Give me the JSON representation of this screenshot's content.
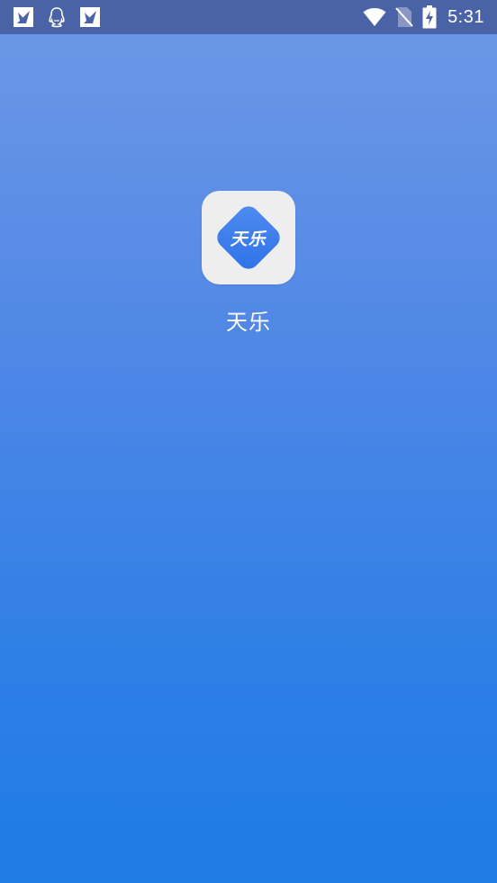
{
  "status_bar": {
    "time": "5:31",
    "left_icons": [
      "gallery-notification-icon",
      "qq-penguin-icon",
      "gallery-notification-icon"
    ],
    "right_icons": [
      "wifi-icon",
      "no-sim-icon",
      "battery-charging-icon"
    ],
    "background_color": "#4a63a6"
  },
  "splash": {
    "logo_text": "天乐",
    "app_name": "天乐",
    "gradient_top": "#6e98e6",
    "gradient_bottom": "#1f7be6",
    "logo_diamond_color": "#3f80ee"
  }
}
